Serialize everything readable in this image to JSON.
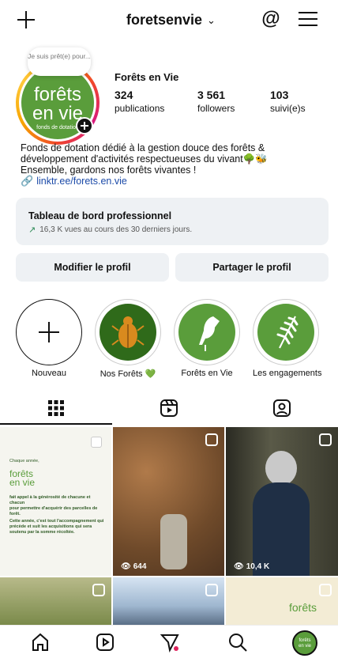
{
  "header": {
    "username": "foretsenvie"
  },
  "profile": {
    "note": "Je suis prêt(e) pour...",
    "avatar_text": [
      "forêts",
      "en vie",
      "fonds de dotation"
    ],
    "display_name": "Forêts en Vie",
    "stats": [
      {
        "value": "324",
        "label": "publications"
      },
      {
        "value": "3 561",
        "label": "followers"
      },
      {
        "value": "103",
        "label": "suivi(e)s"
      }
    ],
    "bio": [
      "Fonds de dotation dédié à la gestion douce des forêts &",
      "développement d'activités respectueuses du vivant🌳🐝",
      "Ensemble, gardons nos forêts vivantes !"
    ],
    "link": "linktr.ee/forets.en.vie"
  },
  "dashboard": {
    "title": "Tableau de bord professionnel",
    "subtitle": "16,3 K vues au cours des 30 derniers jours."
  },
  "actions": {
    "edit": "Modifier le profil",
    "share": "Partager le profil"
  },
  "highlights": [
    {
      "label": "Nouveau"
    },
    {
      "label": "Nos Forêts 💚"
    },
    {
      "label": "Forêts en Vie"
    },
    {
      "label": "Les engagements"
    }
  ],
  "posts": {
    "p1": {
      "lines": [
        "Chaque année,",
        "forêts",
        "en vie",
        "fait appel à la générosité de chacune et chacun",
        "pour permettre d'acquérir des parcelles de",
        "forêt.",
        "Cette année, c'est tout l'accompagnement qui",
        "précède et suit les acquisitions qui sera",
        "soutenu par la somme récoltée."
      ]
    },
    "p2_views": "644",
    "p3_views": "10,4 K",
    "p6_text": "forêts"
  },
  "colors": {
    "green": "#5a9d3b",
    "dark_green": "#2f5b25",
    "link_blue": "#1b4aa8"
  }
}
